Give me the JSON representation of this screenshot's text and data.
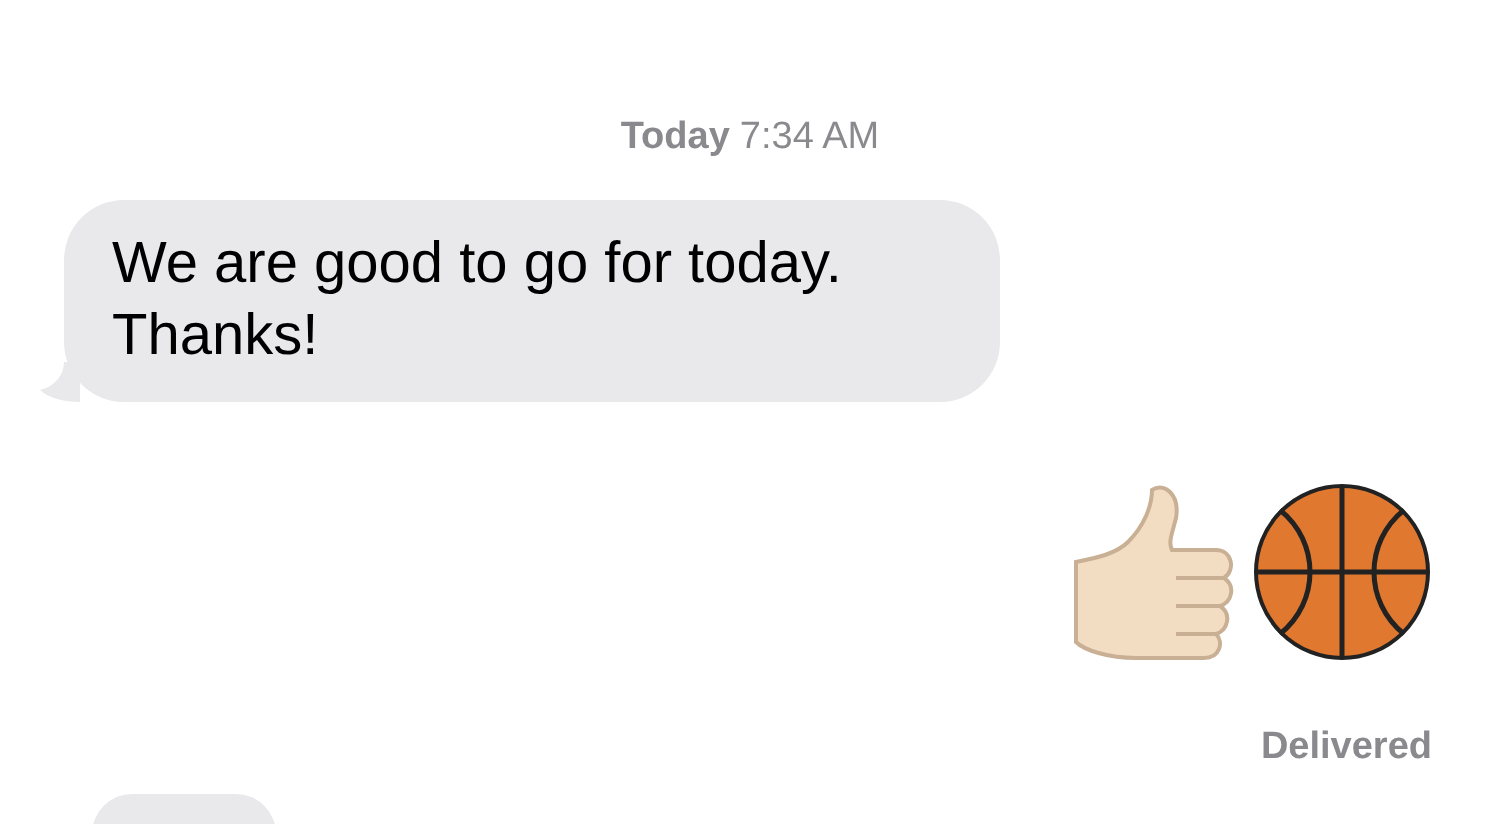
{
  "timestamp": {
    "day": "Today",
    "time": "7:34 AM"
  },
  "messages": [
    {
      "kind": "text",
      "text": "We are good to go for today. Thanks!"
    },
    {
      "kind": "emoji"
    },
    {
      "kind": "status",
      "text": "Delivered"
    },
    {
      "kind": "partial"
    }
  ]
}
